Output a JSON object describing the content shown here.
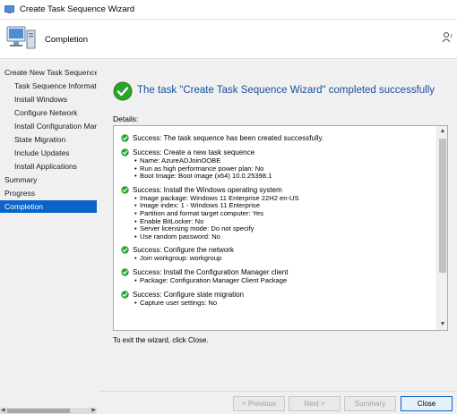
{
  "window": {
    "title": "Create Task Sequence Wizard"
  },
  "header": {
    "title": "Completion"
  },
  "sidebar": {
    "items": [
      {
        "label": "Create New Task Sequence",
        "level": "top",
        "active": false
      },
      {
        "label": "Task Sequence Informatic",
        "level": "sub",
        "active": false
      },
      {
        "label": "Install Windows",
        "level": "sub",
        "active": false
      },
      {
        "label": "Configure Network",
        "level": "sub",
        "active": false
      },
      {
        "label": "Install Configuration Mar",
        "level": "sub",
        "active": false
      },
      {
        "label": "State Migration",
        "level": "sub",
        "active": false
      },
      {
        "label": "Include Updates",
        "level": "sub",
        "active": false
      },
      {
        "label": "Install Applications",
        "level": "sub",
        "active": false
      },
      {
        "label": "Summary",
        "level": "top",
        "active": false
      },
      {
        "label": "Progress",
        "level": "top",
        "active": false
      },
      {
        "label": "Completion",
        "level": "top",
        "active": true
      }
    ]
  },
  "main": {
    "success_message": "The task \"Create Task Sequence Wizard\" completed successfully",
    "details_label": "Details:",
    "details": [
      {
        "head": "Success: The task sequence has been created successfully.",
        "items": []
      },
      {
        "head": "Success: Create a new task sequence",
        "items": [
          "Name: AzureADJoinOOBE",
          "Run as high performance power plan: No",
          "Boot Image: Boot image (x64) 10.0.25398.1"
        ]
      },
      {
        "head": "Success: Install the Windows operating system",
        "items": [
          "Image package: Windows 11 Enterprise 22H2 en-US",
          "Image index: 1 - Windows 11 Enterprise",
          "Partition and format target computer: Yes",
          "Enable BitLocker: No",
          "Server licensing mode: Do not specify",
          "Use random password: No"
        ]
      },
      {
        "head": "Success: Configure the network",
        "items": [
          "Join workgroup: workgroup"
        ]
      },
      {
        "head": "Success: Install the Configuration Manager client",
        "items": [
          "Package: Configuration Manager Client Package"
        ]
      },
      {
        "head": "Success: Configure state migration",
        "items": [
          "Capture user settings: No"
        ]
      }
    ],
    "exit_text": "To exit the wizard, click Close."
  },
  "buttons": {
    "previous": "< Previous",
    "next": "Next >",
    "summary": "Summary",
    "close": "Close"
  },
  "colors": {
    "accent": "#0a64c8",
    "success_green": "#2aa52a",
    "success_text": "#1a4fa0"
  },
  "icons": {
    "app": "wizard-app-icon",
    "header": "computer-icon",
    "help": "help-person-icon",
    "success": "green-check-icon"
  }
}
